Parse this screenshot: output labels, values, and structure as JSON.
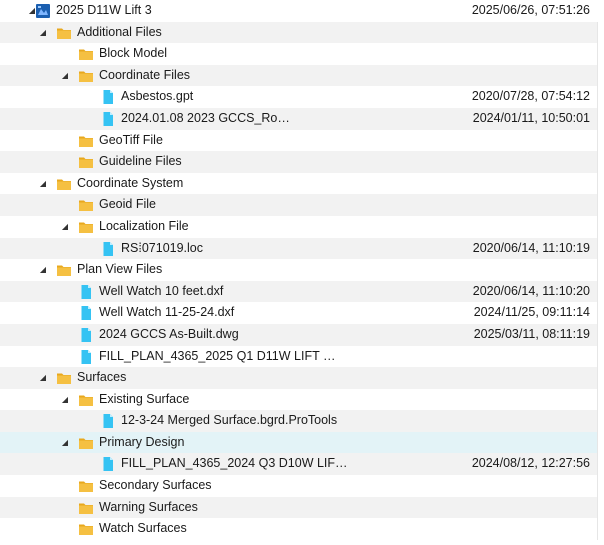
{
  "tree": {
    "rows": [
      {
        "level": 0,
        "type": "project",
        "toggle": "down",
        "label": "2025 D11W Lift 3",
        "date": "2025/06/26, 07:51:26"
      },
      {
        "level": 1,
        "type": "folder",
        "toggle": "down",
        "label": "Additional Files",
        "date": ""
      },
      {
        "level": 2,
        "type": "folder",
        "toggle": "",
        "label": "Block Model",
        "date": ""
      },
      {
        "level": 2,
        "type": "folder",
        "toggle": "down",
        "label": "Coordinate Files",
        "date": ""
      },
      {
        "level": 3,
        "type": "file",
        "toggle": "",
        "label": "Asbestos.gpt",
        "date": "2020/07/28, 07:54:12"
      },
      {
        "level": 3,
        "type": "file",
        "toggle": "",
        "label": "2024.01.08 2023 GCCS_Ro…",
        "date": "2024/01/11, 10:50:01"
      },
      {
        "level": 2,
        "type": "folder",
        "toggle": "",
        "label": "GeoTiff File",
        "date": ""
      },
      {
        "level": 2,
        "type": "folder",
        "toggle": "",
        "label": "Guideline Files",
        "date": ""
      },
      {
        "level": 1,
        "type": "folder",
        "toggle": "down",
        "label": "Coordinate System",
        "date": ""
      },
      {
        "level": 2,
        "type": "folder",
        "toggle": "",
        "label": "Geoid File",
        "date": ""
      },
      {
        "level": 2,
        "type": "folder",
        "toggle": "down",
        "label": "Localization File",
        "date": ""
      },
      {
        "level": 3,
        "type": "file",
        "toggle": "",
        "label": "RS⁞071019.loc",
        "date": "2020/06/14, 11:10:19"
      },
      {
        "level": 1,
        "type": "folder",
        "toggle": "down",
        "label": "Plan View Files",
        "date": ""
      },
      {
        "level": 2,
        "type": "file",
        "toggle": "",
        "label": "Well Watch 10 feet.dxf",
        "date": "2020/06/14, 11:10:20"
      },
      {
        "level": 2,
        "type": "file",
        "toggle": "",
        "label": "Well Watch 11-25-24.dxf",
        "date": "2024/11/25, 09:11:14"
      },
      {
        "level": 2,
        "type": "file",
        "toggle": "",
        "label": "2024 GCCS As-Built.dwg",
        "date": "2025/03/11, 08:11:19"
      },
      {
        "level": 2,
        "type": "file",
        "toggle": "",
        "label": "FILL_PLAN_4365_2025 Q1 D11W LIFT …",
        "date": ""
      },
      {
        "level": 1,
        "type": "folder",
        "toggle": "down",
        "label": "Surfaces",
        "date": ""
      },
      {
        "level": 2,
        "type": "folder",
        "toggle": "down",
        "label": "Existing Surface",
        "date": ""
      },
      {
        "level": 3,
        "type": "file",
        "toggle": "",
        "label": "12-3-24 Merged Surface.bgrd.ProTools",
        "date": ""
      },
      {
        "level": 2,
        "type": "folder",
        "toggle": "down",
        "label": "Primary Design",
        "date": "",
        "selected": true
      },
      {
        "level": 3,
        "type": "file",
        "toggle": "",
        "label": "FILL_PLAN_4365_2024 Q3 D10W LIF…",
        "date": "2024/08/12, 12:27:56"
      },
      {
        "level": 2,
        "type": "folder",
        "toggle": "",
        "label": "Secondary Surfaces",
        "date": ""
      },
      {
        "level": 2,
        "type": "folder",
        "toggle": "",
        "label": "Warning Surfaces",
        "date": ""
      },
      {
        "level": 2,
        "type": "folder",
        "toggle": "",
        "label": "Watch Surfaces",
        "date": ""
      }
    ]
  },
  "colors": {
    "folder": "#f5c042",
    "folder_tab": "#e8a81e",
    "file": "#35c3f3",
    "project": "#1b5fb0",
    "selected_row": "#e3f3f7",
    "alt_row": "#f2f2f2"
  }
}
